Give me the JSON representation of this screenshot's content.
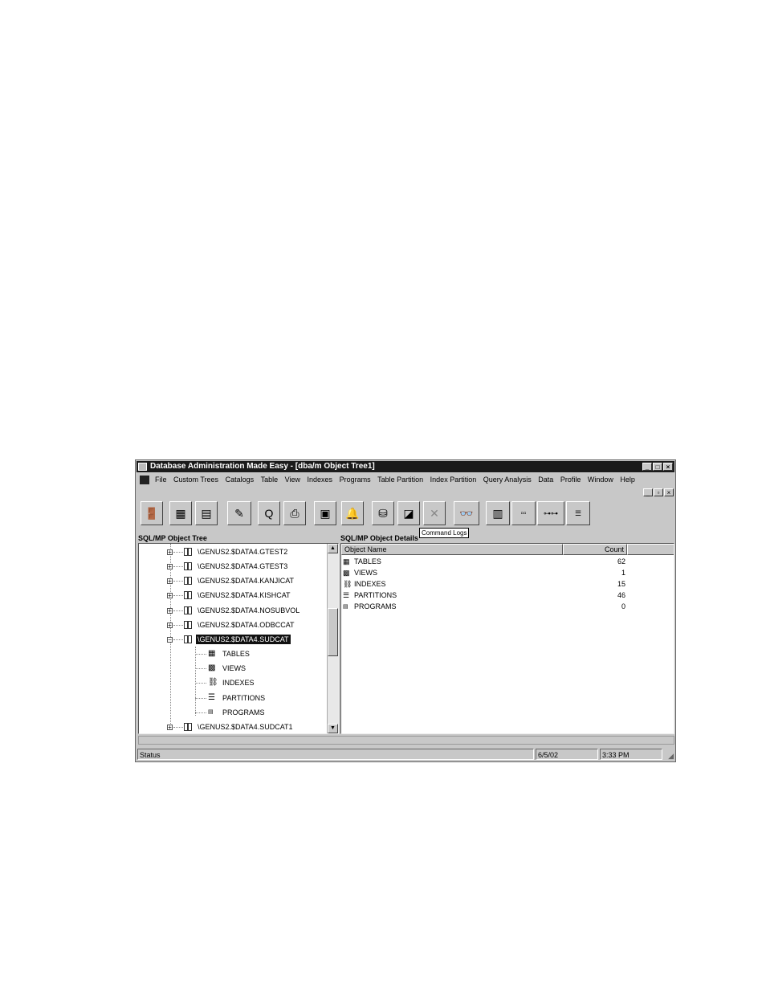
{
  "window": {
    "title": "Database Administration Made Easy - [dba/m Object Tree1]",
    "controls": [
      "_",
      "□",
      "×"
    ]
  },
  "menu": [
    "File",
    "Custom Trees",
    "Catalogs",
    "Table",
    "View",
    "Indexes",
    "Programs",
    "Table Partition",
    "Index Partition",
    "Query Analysis",
    "Data",
    "Profile",
    "Window",
    "Help"
  ],
  "mdi_controls": [
    "_",
    "▫",
    "×"
  ],
  "toolbar": {
    "tooltip": "Command Logs",
    "button_icons": [
      "exit-icon",
      "tree-icon",
      "form-icon",
      "pen-icon",
      "query-icon",
      "printer-icon",
      "disk-icon",
      "bell-icon",
      "database-icon",
      "box-icon",
      "delete-icon",
      "binoculars-icon",
      "grid-icon",
      "details-icon",
      "tree-map-icon",
      "list-icon"
    ]
  },
  "left_panel": {
    "title": "SQL/MP Object Tree",
    "nodes": [
      {
        "label": "\\GENUS2.$DATA4.GTEST2"
      },
      {
        "label": "\\GENUS2.$DATA4.GTEST3"
      },
      {
        "label": "\\GENUS2.$DATA4.KANJICAT"
      },
      {
        "label": "\\GENUS2.$DATA4.KISHCAT"
      },
      {
        "label": "\\GENUS2.$DATA4.NOSUBVOL"
      },
      {
        "label": "\\GENUS2.$DATA4.ODBCCAT"
      },
      {
        "label": "\\GENUS2.$DATA4.SUDCAT",
        "selected": true,
        "expanded": true
      }
    ],
    "children": [
      {
        "label": "TABLES",
        "icon": "table-icon"
      },
      {
        "label": "VIEWS",
        "icon": "view-icon"
      },
      {
        "label": "INDEXES",
        "icon": "index-icon"
      },
      {
        "label": "PARTITIONS",
        "icon": "partition-icon"
      },
      {
        "label": "PROGRAMS",
        "icon": "program-icon"
      }
    ],
    "last_node": {
      "label": "\\GENUS2.$DATA4.SUDCAT1"
    }
  },
  "right_panel": {
    "title": "SQL/MP Object Details",
    "columns": [
      "Object Name",
      "Count"
    ],
    "rows": [
      {
        "name": "TABLES",
        "count": "62",
        "icon": "table-icon"
      },
      {
        "name": "VIEWS",
        "count": "1",
        "icon": "view-icon"
      },
      {
        "name": "INDEXES",
        "count": "15",
        "icon": "index-icon"
      },
      {
        "name": "PARTITIONS",
        "count": "46",
        "icon": "partition-icon"
      },
      {
        "name": "PROGRAMS",
        "count": "0",
        "icon": "program-icon"
      }
    ]
  },
  "statusbar": {
    "status": "Status",
    "date": "6/5/02",
    "time": "3:33 PM"
  }
}
